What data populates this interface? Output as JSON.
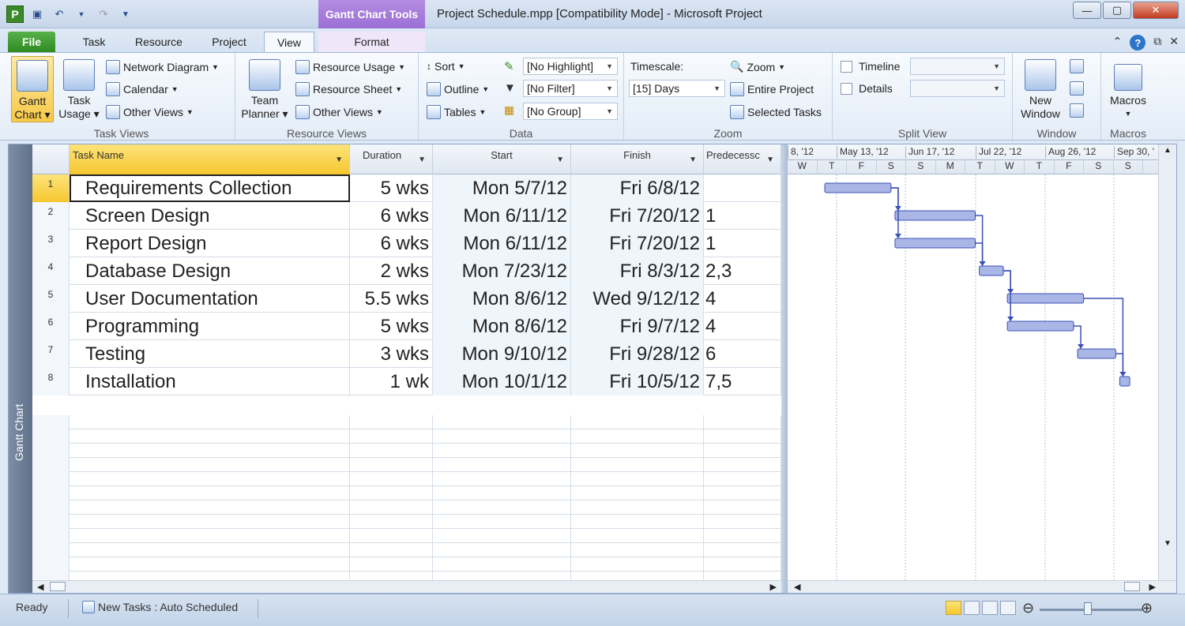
{
  "titlebar": {
    "logo": "P",
    "context_tools": "Gantt Chart Tools",
    "window_title": "Project Schedule.mpp [Compatibility Mode]  -  Microsoft Project"
  },
  "tabs": {
    "file": "File",
    "task": "Task",
    "resource": "Resource",
    "project": "Project",
    "view": "View",
    "format": "Format"
  },
  "ribbon": {
    "task_views": {
      "label": "Task Views",
      "gantt_chart": "Gantt",
      "gantt_chart_2": "Chart",
      "task_usage": "Task",
      "task_usage_2": "Usage",
      "network_diagram": "Network Diagram",
      "calendar": "Calendar",
      "other_views": "Other Views"
    },
    "resource_views": {
      "label": "Resource Views",
      "team_planner": "Team",
      "team_planner_2": "Planner",
      "resource_usage": "Resource Usage",
      "resource_sheet": "Resource Sheet",
      "other_views": "Other Views"
    },
    "data": {
      "label": "Data",
      "sort": "Sort",
      "outline": "Outline",
      "tables": "Tables",
      "highlight": "[No Highlight]",
      "filter": "[No Filter]",
      "group": "[No Group]"
    },
    "zoom": {
      "label": "Zoom",
      "timescale_label": "Timescale:",
      "timescale_value": "[15] Days",
      "zoom": "Zoom",
      "entire_project": "Entire Project",
      "selected_tasks": "Selected Tasks"
    },
    "split_view": {
      "label": "Split View",
      "timeline": "Timeline",
      "details": "Details"
    },
    "window": {
      "label": "Window",
      "new_window": "New",
      "new_window_2": "Window"
    },
    "macros": {
      "label": "Macros",
      "macros": "Macros"
    }
  },
  "view_bar": {
    "label": "Gantt Chart"
  },
  "table": {
    "headers": {
      "task_name": "Task Name",
      "duration": "Duration",
      "start": "Start",
      "finish": "Finish",
      "predecessors": "Predecessc"
    },
    "rows": [
      {
        "id": "1",
        "name": "Requirements Collection",
        "duration": "5 wks",
        "start": "Mon 5/7/12",
        "finish": "Fri 6/8/12",
        "pred": ""
      },
      {
        "id": "2",
        "name": "Screen Design",
        "duration": "6 wks",
        "start": "Mon 6/11/12",
        "finish": "Fri 7/20/12",
        "pred": "1"
      },
      {
        "id": "3",
        "name": "Report Design",
        "duration": "6 wks",
        "start": "Mon 6/11/12",
        "finish": "Fri 7/20/12",
        "pred": "1"
      },
      {
        "id": "4",
        "name": "Database Design",
        "duration": "2 wks",
        "start": "Mon 7/23/12",
        "finish": "Fri 8/3/12",
        "pred": "2,3"
      },
      {
        "id": "5",
        "name": "User Documentation",
        "duration": "5.5 wks",
        "start": "Mon 8/6/12",
        "finish": "Wed 9/12/12",
        "pred": "4"
      },
      {
        "id": "6",
        "name": "Programming",
        "duration": "5 wks",
        "start": "Mon 8/6/12",
        "finish": "Fri 9/7/12",
        "pred": "4"
      },
      {
        "id": "7",
        "name": "Testing",
        "duration": "3 wks",
        "start": "Mon 9/10/12",
        "finish": "Fri 9/28/12",
        "pred": "6"
      },
      {
        "id": "8",
        "name": "Installation",
        "duration": "1 wk",
        "start": "Mon 10/1/12",
        "finish": "Fri 10/5/12",
        "pred": "7,5"
      }
    ]
  },
  "gantt": {
    "months": [
      "8, '12",
      "May 13, '12",
      "Jun 17, '12",
      "Jul 22, '12",
      "Aug 26, '12",
      "Sep 30, '"
    ],
    "days": [
      "W",
      "T",
      "F",
      "S",
      "S",
      "M",
      "T",
      "W",
      "T",
      "F",
      "S",
      "S"
    ],
    "bar_color": "#3c50b4"
  },
  "statusbar": {
    "ready": "Ready",
    "new_tasks": "New Tasks : Auto Scheduled"
  }
}
